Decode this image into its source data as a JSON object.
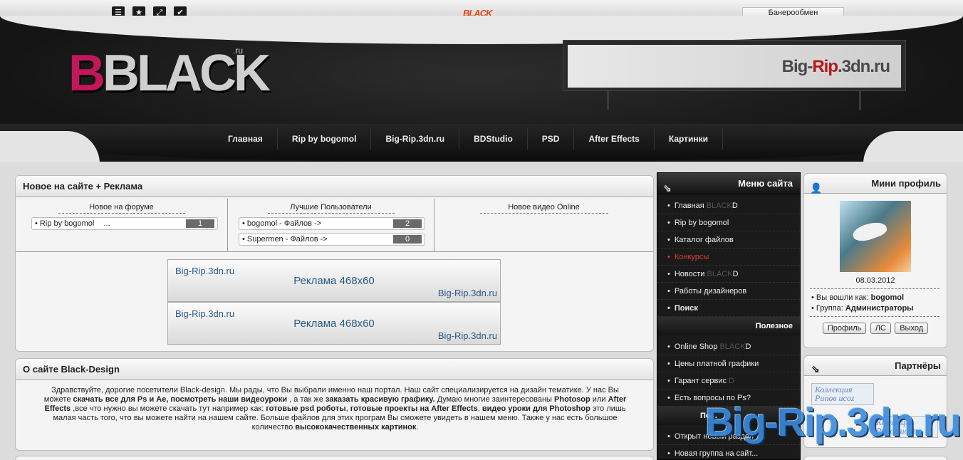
{
  "topbar": {
    "logo_text": "BLACK",
    "banner_exchange": "Банерообмен",
    "icons": [
      "rss-icon",
      "star-icon",
      "share-icon",
      "check-icon"
    ]
  },
  "header": {
    "logo_main": "BLACK",
    "logo_ru": ".ru",
    "billboard_text_1": "Big-",
    "billboard_text_2": "Rip",
    "billboard_text_3": ".3dn.ru"
  },
  "nav": {
    "items": [
      "Главная",
      "Rip by bogomol",
      "Big-Rip.3dn.ru",
      "BDStudio",
      "PSD",
      "After Effects",
      "Картинки"
    ]
  },
  "news_panel": {
    "title": "Новое на сайте + Реклама",
    "forum_title": "Новое на форуме",
    "forum_item": "Rip by bogomol",
    "forum_item_more": "...",
    "forum_count": "1",
    "users_title": "Лучшие Пользователи",
    "users": [
      {
        "name": "bogomol - Файлов ->",
        "count": "2"
      },
      {
        "name": "Supermen - Файлов ->",
        "count": "0"
      }
    ],
    "video_title": "Новое видео Online",
    "ads": [
      {
        "top": "Big-Rip.3dn.ru",
        "mid": "Реклама 468x60",
        "bottom": "Big-Rip.3dn.ru"
      },
      {
        "top": "Big-Rip.3dn.ru",
        "mid": "Реклама 468x60",
        "bottom": "Big-Rip.3dn.ru"
      }
    ]
  },
  "about": {
    "title": "О сайте Black-Design",
    "p1": "Здравствуйте, дорогие посетители Black-design. Мы рады, что Вы выбрали именно наш портал. Наш сайт специализируется на дизайн тематике. У нас Вы можете ",
    "b1": "скачать все для  Ps и Ae, посмотреть наши видеоуроки",
    "p2": " , а так же ",
    "b2": "заказать красивую графику.",
    "p3": " Думаю многие заинтересованы ",
    "b3": "Photosop",
    "p4": " или ",
    "b4": "After Effects",
    "p5": " ,все что нужно вы можете скачать тут например как: ",
    "b5": "готовые psd роботы",
    "p6": ", ",
    "b6": "готовые проекты на After Effects",
    "p7": ", ",
    "b7": "видео уроки для Photoshop",
    "p8": " это лишь малая часть того, что вы можете найти на нашем сайте. Больше файлов для этих програм Вы сможете увидеть в нашем меню. Также у нас есть большое количество ",
    "b8": "высококачественных картинок",
    "p9": "."
  },
  "menu": {
    "title": "Меню сайта",
    "items": [
      {
        "label": "Главная",
        "suffix_gray": "BLACK",
        "suffix": "D"
      },
      {
        "label": "Rip by bogomol"
      },
      {
        "label": "Каталог файлов"
      },
      {
        "label": "Конкурсы"
      },
      {
        "label": "Новости",
        "suffix_gray": "BLACK",
        "suffix": "D"
      },
      {
        "label": "Работы дизайнеров"
      },
      {
        "label": "Поиск"
      }
    ],
    "useful_title": "Полезное",
    "useful": [
      {
        "label": "Online Shop",
        "suffix_gray": "BLACK",
        "suffix": "D"
      },
      {
        "label": "Цены платной графики"
      },
      {
        "label": "Гарант сервис",
        "suffix_gray": "",
        "suffix": "D"
      },
      {
        "label": "Есть вопросы по Ps?"
      }
    ],
    "forum_title": "Последнее на форуме",
    "forum_title_partial": "По...",
    "forum": [
      "Открыт новый раздел ...",
      "Новая группа на сайт..."
    ]
  },
  "profile": {
    "title": "Мини профиль",
    "date": "08.03.2012",
    "logged_label": "Вы вошли как:",
    "logged_user": "bogomol",
    "group_label": "Группа:",
    "group": "Администраторы",
    "btn_profile": "Профиль",
    "btn_pm": "ЛС",
    "btn_exit": "Выход"
  },
  "partners": {
    "title": "Партнёры",
    "badge1": "Коллекция Рипов ucoz",
    "badge2": "Коллекция Рипов ucoz"
  },
  "watermark": "Big-Rip.3dn.ru"
}
